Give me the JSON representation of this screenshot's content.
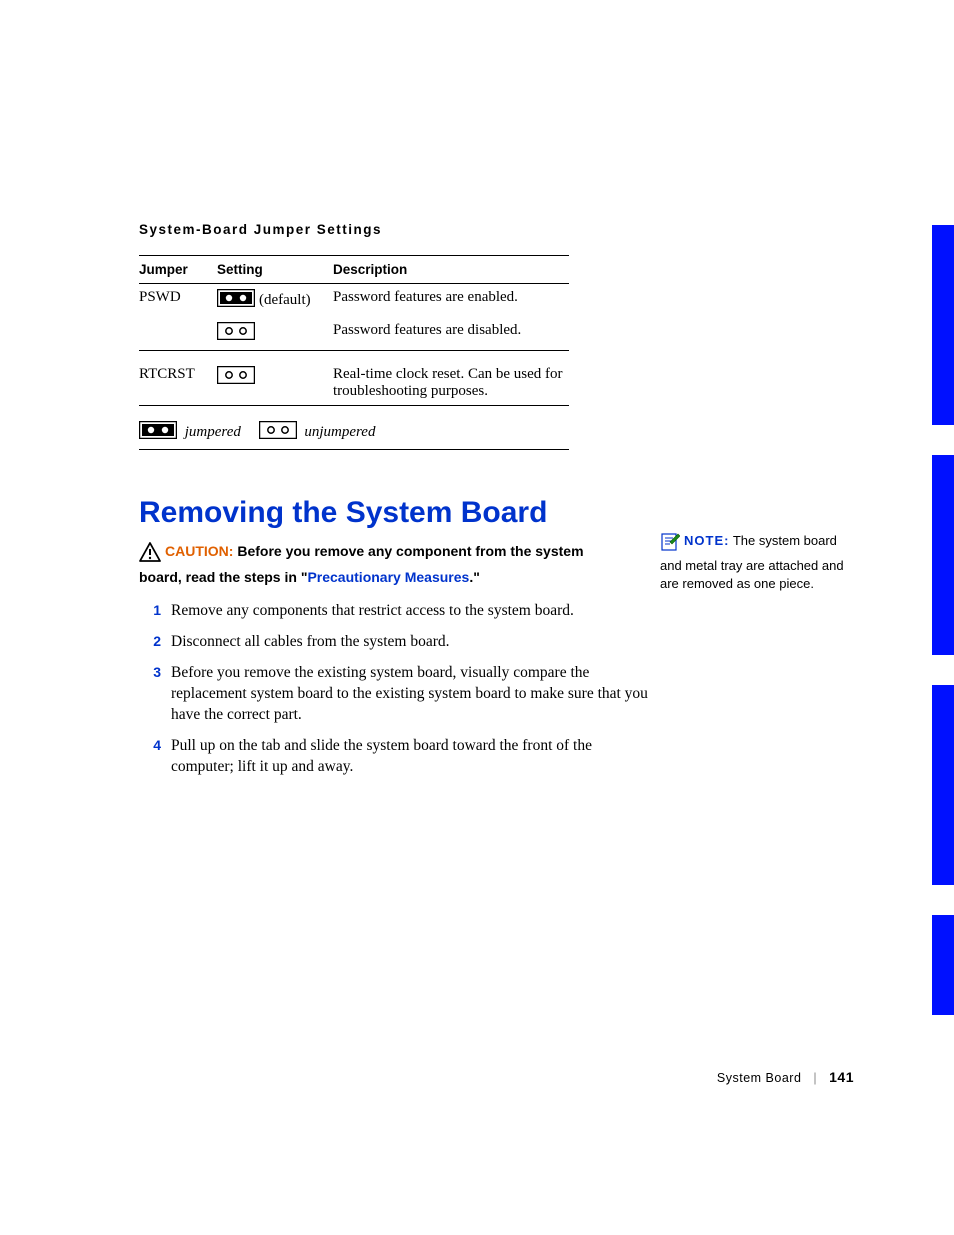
{
  "section_title": "System-Board Jumper Settings",
  "table": {
    "headers": {
      "jumper": "Jumper",
      "setting": "Setting",
      "description": "Description"
    },
    "rows": [
      {
        "jumper": "PSWD",
        "setting_extra": "(default)",
        "jumpered": true,
        "description": "Password features are enabled."
      },
      {
        "jumper": "",
        "setting_extra": "",
        "jumpered": false,
        "description": "Password features are disabled."
      },
      {
        "jumper": "RTCRST",
        "setting_extra": "",
        "jumpered": false,
        "description": "Real-time clock reset. Can be used for troubleshooting purposes."
      }
    ],
    "legend": {
      "jumpered": "jumpered",
      "unjumpered": "unjumpered"
    }
  },
  "heading": "Removing the System Board",
  "caution": {
    "label": "CAUTION:",
    "text_before": "Before you remove any component from the system board, read the steps in \"",
    "link": "Precautionary Measures",
    "text_after": ".\""
  },
  "steps": [
    "Remove any components that restrict access to the system board.",
    "Disconnect all cables from the system board.",
    "Before you remove the existing system board, visually compare the replacement system board to the existing system board to make sure that you have the correct part.",
    "Pull up on the tab and slide the system board toward the front of the computer; lift it up and away."
  ],
  "step_numbers": [
    "1",
    "2",
    "3",
    "4"
  ],
  "note": {
    "label": "NOTE:",
    "text": "The system board and metal tray are attached and are removed as one piece."
  },
  "footer": {
    "section": "System Board",
    "page": "141"
  }
}
